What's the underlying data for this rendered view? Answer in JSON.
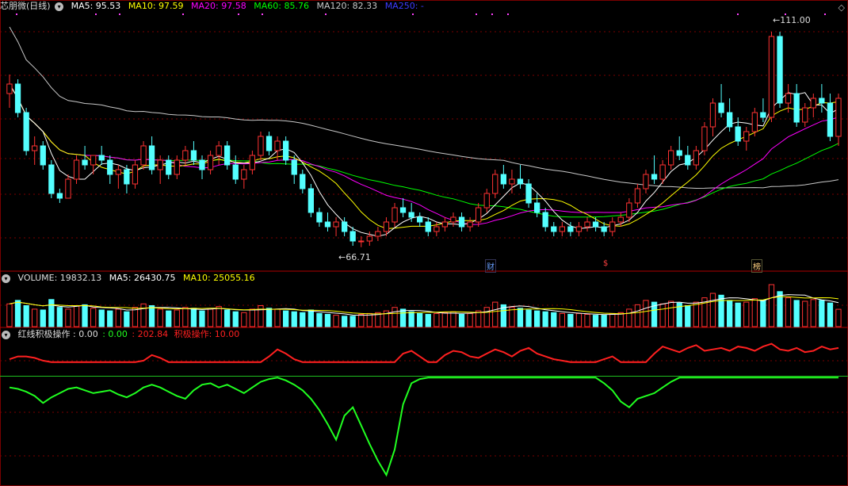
{
  "main_header": {
    "stock_name": "芯朋微(日线)",
    "ma5": "MA5: 95.53",
    "ma10": "MA10: 97.59",
    "ma20": "MA20: 97.58",
    "ma60": "MA60: 85.76",
    "ma120": "MA120: 82.33",
    "ma250": "MA250: -"
  },
  "volume_header": {
    "volume": "VOLUME: 19832.13",
    "ma5": "MA5: 26430.75",
    "ma10": "MA10: 25055.16"
  },
  "indicator_header": {
    "name": "红线积极操作 : 0.00",
    "v1": ": 0.00",
    "v2": ": 202.84",
    "v3": "积极操作: 10.00"
  },
  "annotations": {
    "high_label": "111.00",
    "low_label": "66.71",
    "event_finance": "财",
    "event_dollar": "$",
    "event_list": "榜"
  },
  "colors": {
    "up": "#ff3232",
    "down": "#54ffff",
    "ma5": "#ffffff",
    "ma10": "#ffff00",
    "ma20": "#ff00ff",
    "ma60": "#00ff00",
    "ma120": "#c8c8c8",
    "ma250": "#3c3cff",
    "red_line": "#ff2020",
    "green_line": "#20ff20",
    "grid": "#7a0000"
  },
  "chart_data": {
    "type": "candlestick",
    "price_range": [
      62,
      116
    ],
    "high": 111.0,
    "low": 66.71,
    "candles_ohlc": [
      [
        99,
        103,
        96,
        101
      ],
      [
        101,
        102,
        94,
        95
      ],
      [
        95,
        96,
        86,
        87
      ],
      [
        87,
        90,
        84,
        88
      ],
      [
        88,
        89,
        83,
        84
      ],
      [
        84,
        85,
        77,
        78
      ],
      [
        78,
        79,
        76,
        77
      ],
      [
        77,
        82,
        77,
        81
      ],
      [
        81,
        86,
        80,
        85
      ],
      [
        85,
        88,
        83,
        84
      ],
      [
        84,
        86,
        82,
        86
      ],
      [
        86,
        88,
        84,
        85
      ],
      [
        85,
        86,
        80,
        82
      ],
      [
        82,
        84,
        79,
        83
      ],
      [
        83,
        84,
        78,
        80
      ],
      [
        80,
        85,
        79,
        84
      ],
      [
        84,
        89,
        83,
        88
      ],
      [
        88,
        90,
        82,
        83
      ],
      [
        83,
        86,
        80,
        85
      ],
      [
        85,
        86,
        81,
        82
      ],
      [
        82,
        86,
        81,
        85
      ],
      [
        85,
        88,
        84,
        87
      ],
      [
        87,
        89,
        84,
        85
      ],
      [
        85,
        86,
        81,
        83
      ],
      [
        83,
        87,
        82,
        86
      ],
      [
        86,
        89,
        84,
        88
      ],
      [
        88,
        89,
        83,
        84
      ],
      [
        84,
        86,
        80,
        81
      ],
      [
        81,
        84,
        79,
        83
      ],
      [
        83,
        87,
        82,
        86
      ],
      [
        86,
        91,
        85,
        90
      ],
      [
        90,
        91,
        86,
        87
      ],
      [
        87,
        90,
        85,
        89
      ],
      [
        89,
        90,
        84,
        85
      ],
      [
        85,
        86,
        80,
        82
      ],
      [
        82,
        83,
        78,
        79
      ],
      [
        79,
        80,
        73,
        74
      ],
      [
        74,
        75,
        71,
        72
      ],
      [
        72,
        74,
        70,
        71
      ],
      [
        71,
        73,
        69,
        72
      ],
      [
        72,
        73,
        69,
        70
      ],
      [
        70,
        71,
        67,
        68
      ],
      [
        68,
        69,
        66.71,
        68
      ],
      [
        68,
        70,
        67,
        69
      ],
      [
        69,
        71,
        68,
        70
      ],
      [
        70,
        73,
        69,
        72
      ],
      [
        72,
        76,
        71,
        75
      ],
      [
        75,
        77,
        73,
        74
      ],
      [
        74,
        76,
        72,
        73
      ],
      [
        73,
        74,
        71,
        72
      ],
      [
        72,
        73,
        69,
        70
      ],
      [
        70,
        72,
        69,
        71
      ],
      [
        71,
        73,
        70,
        72
      ],
      [
        72,
        74,
        71,
        73
      ],
      [
        73,
        74,
        70,
        71
      ],
      [
        71,
        73,
        70,
        72
      ],
      [
        72,
        76,
        71,
        75
      ],
      [
        75,
        79,
        74,
        78
      ],
      [
        78,
        83,
        77,
        82
      ],
      [
        82,
        84,
        79,
        80
      ],
      [
        80,
        83,
        78,
        81
      ],
      [
        81,
        84,
        79,
        80
      ],
      [
        80,
        81,
        75,
        76
      ],
      [
        76,
        78,
        73,
        74
      ],
      [
        74,
        75,
        70,
        71
      ],
      [
        71,
        72,
        69,
        70
      ],
      [
        70,
        72,
        69,
        71
      ],
      [
        71,
        72,
        69,
        70
      ],
      [
        70,
        72,
        69,
        71
      ],
      [
        71,
        73,
        70,
        72
      ],
      [
        72,
        73,
        70,
        71
      ],
      [
        71,
        72,
        69,
        70
      ],
      [
        70,
        73,
        69,
        72
      ],
      [
        72,
        74,
        71,
        73
      ],
      [
        73,
        77,
        72,
        76
      ],
      [
        76,
        80,
        75,
        79
      ],
      [
        79,
        83,
        78,
        82
      ],
      [
        82,
        86,
        80,
        81
      ],
      [
        81,
        85,
        80,
        84
      ],
      [
        84,
        88,
        83,
        87
      ],
      [
        87,
        90,
        85,
        86
      ],
      [
        86,
        88,
        83,
        84
      ],
      [
        84,
        88,
        83,
        87
      ],
      [
        87,
        93,
        86,
        92
      ],
      [
        92,
        98,
        90,
        97
      ],
      [
        97,
        101,
        94,
        95
      ],
      [
        95,
        98,
        91,
        92
      ],
      [
        92,
        94,
        88,
        89
      ],
      [
        89,
        92,
        87,
        91
      ],
      [
        91,
        96,
        90,
        95
      ],
      [
        95,
        98,
        93,
        94
      ],
      [
        94,
        112,
        93,
        111
      ],
      [
        111,
        112,
        96,
        97
      ],
      [
        97,
        101,
        95,
        99
      ],
      [
        99,
        101,
        92,
        93
      ],
      [
        93,
        97,
        92,
        96
      ],
      [
        96,
        99,
        94,
        98
      ],
      [
        98,
        101,
        95,
        97
      ],
      [
        97,
        99,
        89,
        90
      ],
      [
        90,
        99,
        88,
        98
      ]
    ],
    "volume": [
      26000,
      30000,
      24000,
      20000,
      19000,
      31000,
      22000,
      20000,
      24000,
      25000,
      21000,
      19000,
      18000,
      20000,
      17000,
      22000,
      26000,
      24000,
      20000,
      18000,
      19000,
      22000,
      21000,
      18000,
      20000,
      23000,
      19000,
      17000,
      16000,
      20000,
      24000,
      21000,
      20000,
      18000,
      17000,
      16000,
      19000,
      15000,
      14000,
      13000,
      12000,
      12000,
      14000,
      15000,
      16000,
      18000,
      22000,
      20000,
      17000,
      15000,
      14000,
      15000,
      16000,
      17000,
      14000,
      15000,
      18000,
      22000,
      28000,
      25000,
      22000,
      21000,
      19000,
      18000,
      17000,
      16000,
      15000,
      14000,
      15000,
      14000,
      13000,
      13000,
      15000,
      16000,
      20000,
      25000,
      30000,
      28000,
      26000,
      29000,
      27000,
      24000,
      28000,
      33000,
      38000,
      36000,
      30000,
      27000,
      28000,
      32000,
      30000,
      48000,
      40000,
      33000,
      30000,
      29000,
      31000,
      30000,
      27000,
      19832.13
    ],
    "indicator_red": [
      12,
      14,
      14,
      13,
      11,
      10,
      10,
      10,
      10,
      10,
      10,
      10,
      10,
      10,
      10,
      10,
      11,
      15,
      13,
      10,
      10,
      10,
      10,
      10,
      10,
      10,
      10,
      10,
      10,
      10,
      10,
      14,
      19,
      16,
      12,
      10,
      10,
      10,
      10,
      10,
      10,
      10,
      10,
      10,
      10,
      10,
      10,
      16,
      18,
      14,
      10,
      10,
      15,
      18,
      17,
      14,
      13,
      16,
      19,
      17,
      14,
      18,
      20,
      16,
      14,
      12,
      11,
      10,
      10,
      10,
      10,
      12,
      14,
      10,
      10,
      10,
      10,
      16,
      21,
      19,
      17,
      20,
      22,
      18,
      19,
      20,
      18,
      21,
      20,
      18,
      21,
      23,
      19,
      18,
      20,
      17,
      18,
      21,
      19,
      20
    ],
    "indicator_green": [
      -8,
      -9,
      -11,
      -14,
      -19,
      -15,
      -12,
      -9,
      -8,
      -10,
      -12,
      -11,
      -10,
      -13,
      -15,
      -12,
      -8,
      -6,
      -8,
      -11,
      -14,
      -16,
      -10,
      -6,
      -5,
      -8,
      -6,
      -9,
      -12,
      -8,
      -4,
      -2,
      -1,
      -3,
      -6,
      -10,
      -16,
      -24,
      -34,
      -45,
      -28,
      -22,
      -35,
      -48,
      -60,
      -70,
      -52,
      -20,
      -5,
      -2,
      -1,
      -1,
      -1,
      -1,
      -1,
      -1,
      -1,
      -1,
      -1,
      -1,
      -1,
      -1,
      -1,
      -1,
      -1,
      -1,
      -1,
      -1,
      -1,
      -1,
      -1,
      -5,
      -10,
      -18,
      -22,
      -16,
      -14,
      -12,
      -8,
      -4,
      -1,
      -1,
      -1,
      -1,
      -1,
      -1,
      -1,
      -1,
      -1,
      -1,
      -1,
      -1,
      -1,
      -1,
      -1,
      -1,
      -1,
      -1,
      -1,
      -1
    ],
    "indicator_range": [
      -75,
      25
    ]
  }
}
